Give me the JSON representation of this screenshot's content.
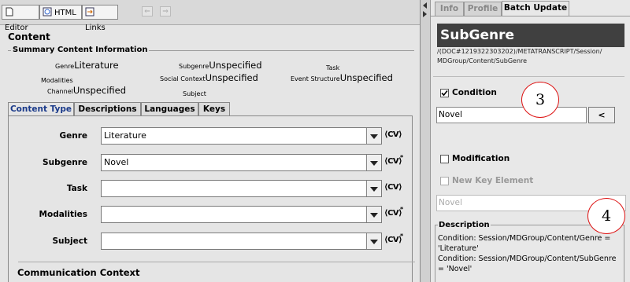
{
  "toolbar": {
    "editor_label": "Editor",
    "html_label": "HTML",
    "links_label": "Links"
  },
  "content": {
    "title": "Content",
    "summary": {
      "legend": "Summary Content Information",
      "genre_label": "Genre",
      "genre_value": "Literature",
      "subgenre_label": "Subgenre",
      "subgenre_value": "Unspecified",
      "task_label": "Task",
      "modalities_label": "Modalities",
      "social_context_label": "Social Context",
      "social_context_value": "Unspecified",
      "event_structure_label": "Event Structure",
      "event_structure_value": "Unspecified",
      "channel_label": "Channel",
      "channel_value": "Unspecified",
      "subject_label": "Subject"
    },
    "tabs": [
      "Content Type",
      "Descriptions",
      "Languages",
      "Keys"
    ],
    "fields": {
      "genre": {
        "label": "Genre",
        "value": "Literature"
      },
      "subgenre": {
        "label": "Subgenre",
        "value": "Novel"
      },
      "task": {
        "label": "Task",
        "value": ""
      },
      "modalities": {
        "label": "Modalities",
        "value": ""
      },
      "subject": {
        "label": "Subject",
        "value": ""
      }
    },
    "cv_label": "CV",
    "star": "*",
    "communication_context": "Communication Context"
  },
  "right": {
    "tabs": [
      "Info",
      "Profile",
      "Batch Update"
    ],
    "title": "SubGenre",
    "path_line1": "/(DOC#1219322303202)/METATRANSCRIPT/Session/",
    "path_line2": "MDGroup/Content/SubGenre",
    "condition_label": "Condition",
    "condition_value": "Novel",
    "lt_button": "<",
    "modification_label": "Modification",
    "new_key_label": "New Key Element",
    "modification_value": "Novel",
    "description_legend": "Description",
    "description_lines": [
      "Condition: Session/MDGroup/Content/Genre =",
      "'Literature'",
      "Condition: Session/MDGroup/Content/SubGenre",
      "= 'Novel'"
    ],
    "callout_3": "3",
    "callout_4": "4"
  },
  "colors": {
    "title_bar": "#404040",
    "callout": "#dd1111",
    "active_tab_text": "#1a3a8a"
  }
}
